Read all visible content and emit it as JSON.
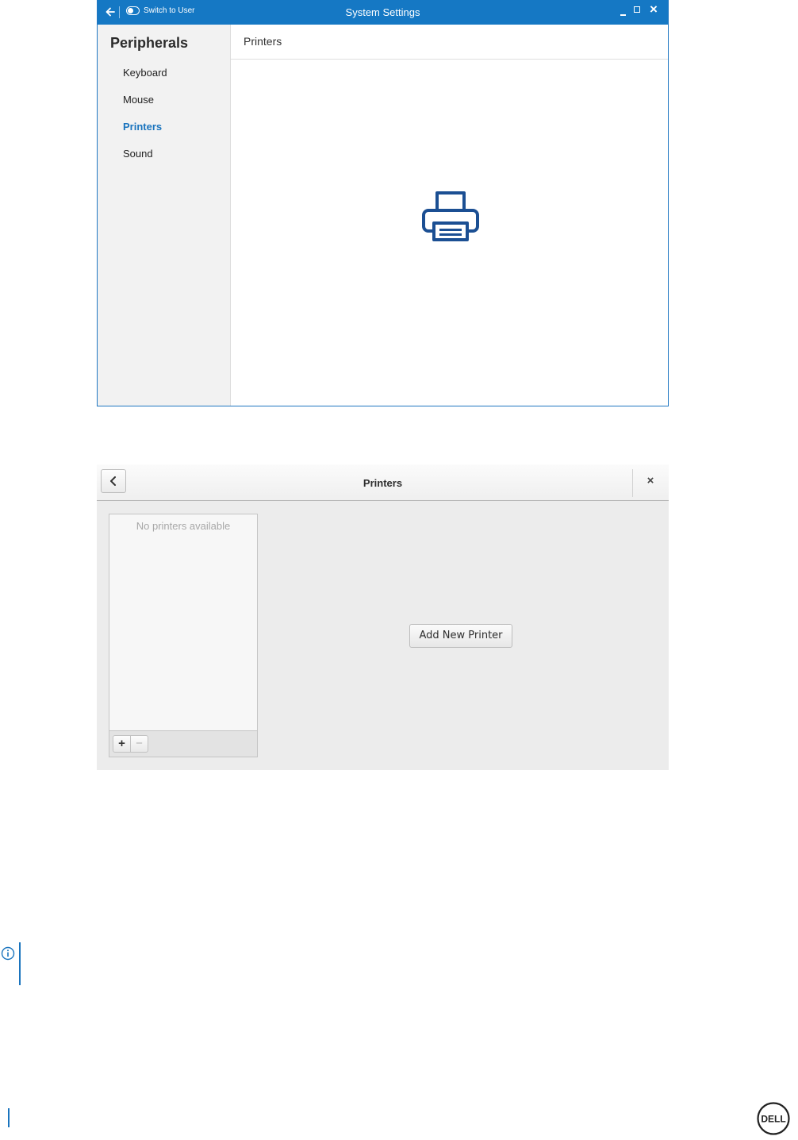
{
  "system_settings": {
    "title": "System Settings",
    "switch_label": "Switch to User",
    "sidebar": {
      "title": "Peripherals",
      "items": [
        {
          "label": "Keyboard",
          "active": false
        },
        {
          "label": "Mouse",
          "active": false
        },
        {
          "label": "Printers",
          "active": true
        },
        {
          "label": "Sound",
          "active": false
        }
      ]
    },
    "content_title": "Printers",
    "accent_color": "#1578c4"
  },
  "printers_dialog": {
    "title": "Printers",
    "empty_list_text": "No printers available",
    "add_button_label": "Add New Printer",
    "add_symbol": "+",
    "remove_symbol": "−",
    "close_symbol": "×"
  },
  "icons": {
    "printer": "printer-icon",
    "note": "info-icon",
    "logo": "dell-logo"
  }
}
